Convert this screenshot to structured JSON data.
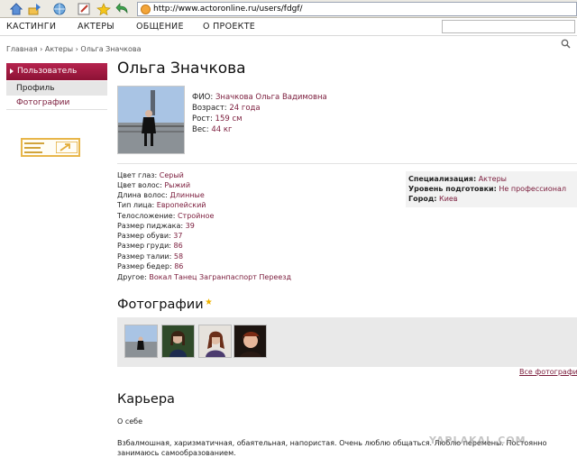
{
  "browser": {
    "address": "http://www.actoronline.ru/users/fdgf/"
  },
  "topnav": {
    "items": [
      "КАСТИНГИ",
      "АКТЕРЫ",
      "ОБЩЕНИЕ",
      "О ПРОЕКТЕ"
    ]
  },
  "breadcrumb": "Главная › Актеры › Ольга Значкова",
  "sidebar": {
    "header": "Пользователь",
    "items": [
      "Профиль",
      "Фотографии"
    ]
  },
  "profile": {
    "name": "Ольга Значкова",
    "fio_label": "ФИО:",
    "fio": "Значкова Ольга Вадимовна",
    "age_label": "Возраст:",
    "age": "24 года",
    "height_label": "Рост:",
    "height": "159 см",
    "weight_label": "Вес:",
    "weight": "44 кг"
  },
  "attributes": [
    {
      "label": "Цвет глаз:",
      "value": "Серый"
    },
    {
      "label": "Цвет волос:",
      "value": "Рыжий"
    },
    {
      "label": "Длина волос:",
      "value": "Длинные"
    },
    {
      "label": "Тип лица:",
      "value": "Европейский"
    },
    {
      "label": "Телосложение:",
      "value": "Стройное"
    },
    {
      "label": "Размер пиджака:",
      "value": "39"
    },
    {
      "label": "Размер обуви:",
      "value": "37"
    },
    {
      "label": "Размер груди:",
      "value": "86"
    },
    {
      "label": "Размер талии:",
      "value": "58"
    },
    {
      "label": "Размер бедер:",
      "value": "86"
    },
    {
      "label": "Другое:",
      "value": "Вокал Танец Загранпаспорт Переезд"
    }
  ],
  "specs": [
    {
      "label": "Специализация:",
      "value": "Актеры"
    },
    {
      "label": "Уровень подготовки:",
      "value": "Не профессионал"
    },
    {
      "label": "Город:",
      "value": "Киев"
    }
  ],
  "photos": {
    "title": "Фотографии",
    "all_link": "Все фотографии"
  },
  "career": {
    "title": "Карьера",
    "about_label": "О себе",
    "about_text": "Взбалмошная, харизматичная, обаятельная, напористая. Очень люблю общаться. Люблю перемены. Постоянно занимаюсь самообразованием."
  },
  "watermark": "YAPLAKAL.COM",
  "colors": {
    "accent": "#8d1235",
    "link": "#7a1b3b"
  }
}
